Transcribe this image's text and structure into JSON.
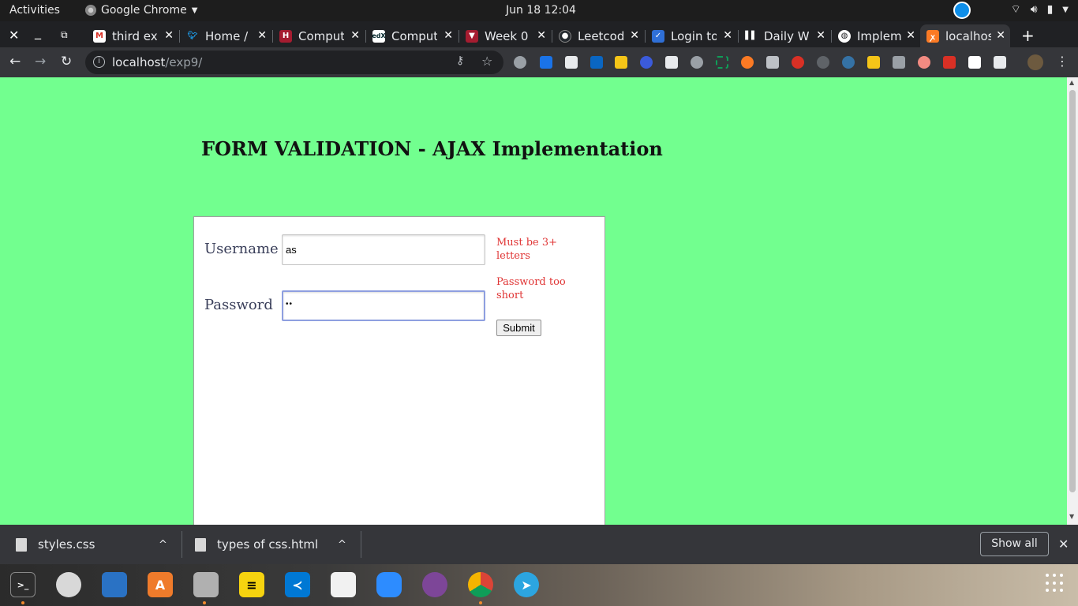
{
  "topbar": {
    "activities": "Activities",
    "app_name": "Google Chrome",
    "clock": "Jun 18  12:04"
  },
  "tabs": [
    {
      "title": "third ex",
      "icon": "gmail-icon",
      "color": "#d93025"
    },
    {
      "title": "Home /",
      "icon": "twitter-icon",
      "color": "#1da1f2"
    },
    {
      "title": "Comput",
      "icon": "harvard-icon",
      "color": "#a51c30"
    },
    {
      "title": "Comput",
      "icon": "edx-icon",
      "color": "#02262b"
    },
    {
      "title": "Week 0",
      "icon": "harvard-shield-icon",
      "color": "#a51c30"
    },
    {
      "title": "Leetcod",
      "icon": "github-icon",
      "color": "#24292e"
    },
    {
      "title": "Login to",
      "icon": "login-icon",
      "color": "#2f6fd6"
    },
    {
      "title": "Daily W",
      "icon": "trello-icon",
      "color": "#ffffff"
    },
    {
      "title": "Implem",
      "icon": "globe-icon",
      "color": "#ffffff"
    },
    {
      "title": "localhos",
      "icon": "xampp-icon",
      "color": "#fb7a24"
    }
  ],
  "address": {
    "host": "localhost",
    "path": "/exp9/"
  },
  "page": {
    "title": "FORM VALIDATION - AJAX Implementation",
    "username_label": "Username",
    "username_value": "as",
    "username_error": "Must be 3+ letters",
    "password_label": "Password",
    "password_value": "as",
    "password_error": "Password too short",
    "submit_label": "Submit",
    "background_color": "#72ff8f"
  },
  "downloads": {
    "items": [
      {
        "name": "styles.css"
      },
      {
        "name": "types of css.html"
      }
    ],
    "show_all": "Show all"
  }
}
